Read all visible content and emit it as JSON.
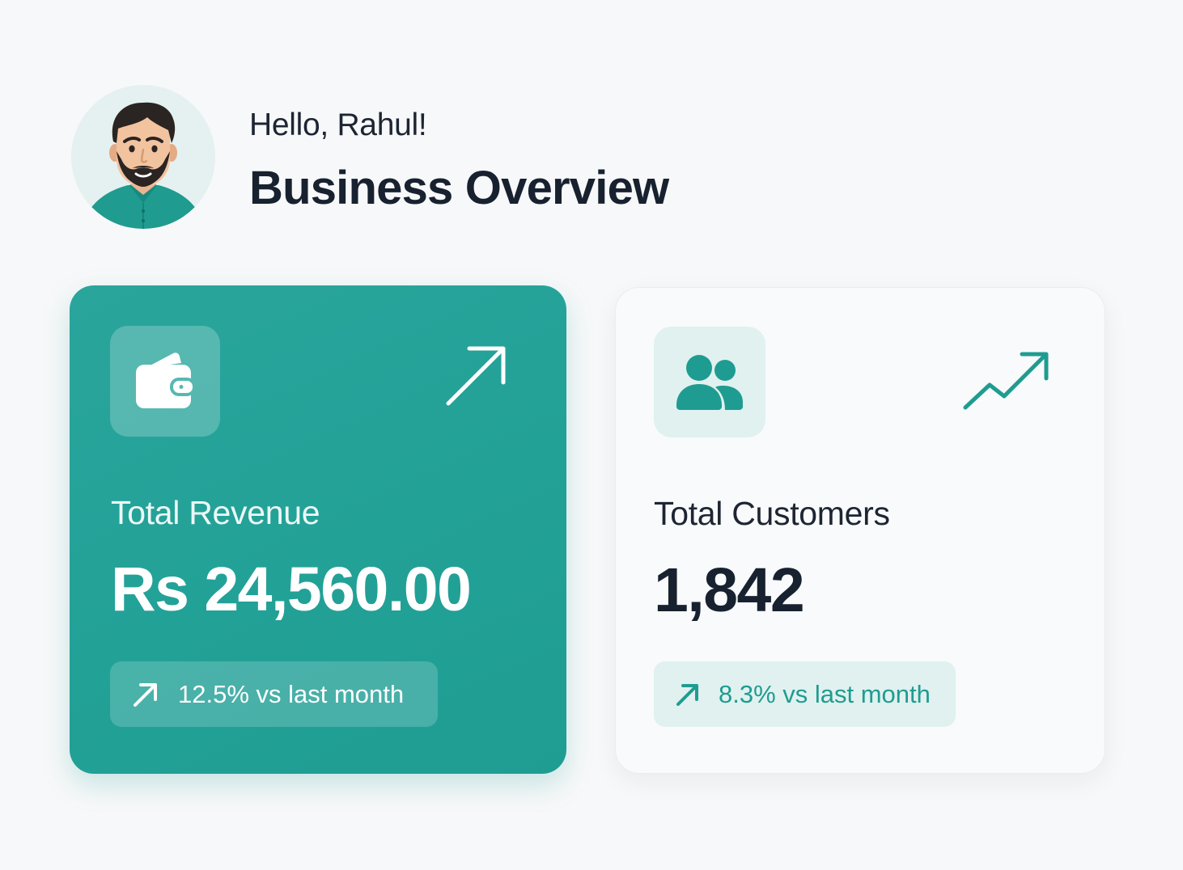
{
  "header": {
    "greeting": "Hello, Rahul!",
    "title": "Business Overview",
    "avatar_icon": "user-avatar-illustration"
  },
  "cards": {
    "revenue": {
      "label": "Total Revenue",
      "value": "Rs 24,560.00",
      "change": "12.5% vs last month",
      "icon": "wallet-icon",
      "trend_icon": "arrow-up-right-icon"
    },
    "customers": {
      "label": "Total Customers",
      "value": "1,842",
      "change": "8.3% vs last month",
      "icon": "users-icon",
      "trend_icon": "trending-up-icon"
    }
  },
  "colors": {
    "accent": "#22a197",
    "accent_text": "#1f9c91",
    "page_background": "#f7f8f9",
    "tile_background": "#e0f1ef",
    "heading": "#17212f"
  }
}
